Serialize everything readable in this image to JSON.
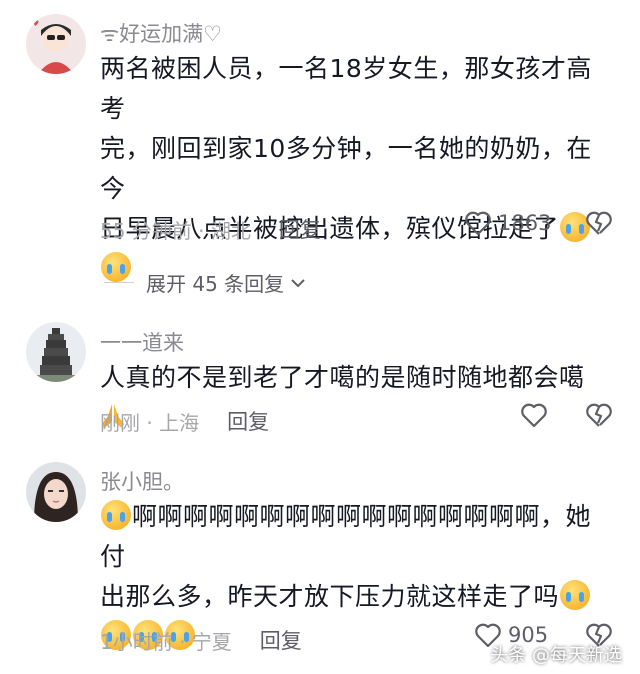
{
  "comments": [
    {
      "username": "ᯤ好运加满♡",
      "text_line1": "两名被困人员，一名18岁女生，那女孩才高考",
      "text_line2": "完，刚回到家10多分钟，一名她的奶奶，在今",
      "text_line3": "日早晨八点半被挖出遗体，殡仪馆拉走了",
      "time_location": "55 分钟前 · 湖北",
      "reply_label": "回复",
      "like_count": "1863",
      "emoji": [
        "crying-face",
        "crying-face"
      ]
    },
    {
      "username": "一一道来",
      "text_line1": "人真的不是到老了才噶的是随时随地都会噶",
      "time_location": "刚刚 · 上海",
      "reply_label": "回复",
      "like_count": "",
      "emoji": [
        "praying-hands"
      ]
    },
    {
      "username": "张小胆。",
      "text_line1": "啊啊啊啊啊啊啊啊啊啊啊啊啊啊啊啊，她付",
      "text_line2": "出那么多，昨天才放下压力就这样走了吗",
      "time_location": "1小时前 · 宁夏",
      "reply_label": "回复",
      "like_count": "905",
      "emoji": [
        "crying-face",
        "crying-face",
        "crying-face",
        "crying-face",
        "crying-face"
      ]
    }
  ],
  "expand_replies": "展开 45 条回复",
  "watermark": "头条 @每天新选"
}
